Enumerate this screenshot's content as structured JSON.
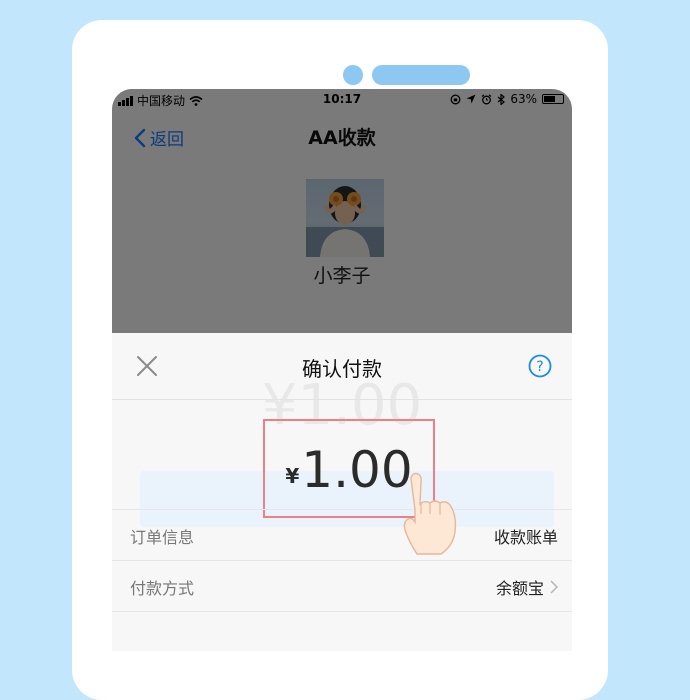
{
  "status_bar": {
    "carrier": "中国移动",
    "time": "10:17",
    "battery": "63%",
    "battery_level": 0.63
  },
  "nav": {
    "back_label": "返回",
    "title": "AA收款"
  },
  "payee": {
    "name": "小李子"
  },
  "sheet": {
    "title": "确认付款",
    "close_icon": "close-icon",
    "help_icon": "help-icon",
    "currency_symbol": "¥",
    "amount": "1.00",
    "order_info_label": "订单信息",
    "order_info_value": "收款账单",
    "payment_method_label": "付款方式",
    "payment_method_value": "余额宝"
  },
  "colors": {
    "background": "#c2e6fb",
    "accent": "#1677ff",
    "highlight_border": "#ee7f86"
  }
}
